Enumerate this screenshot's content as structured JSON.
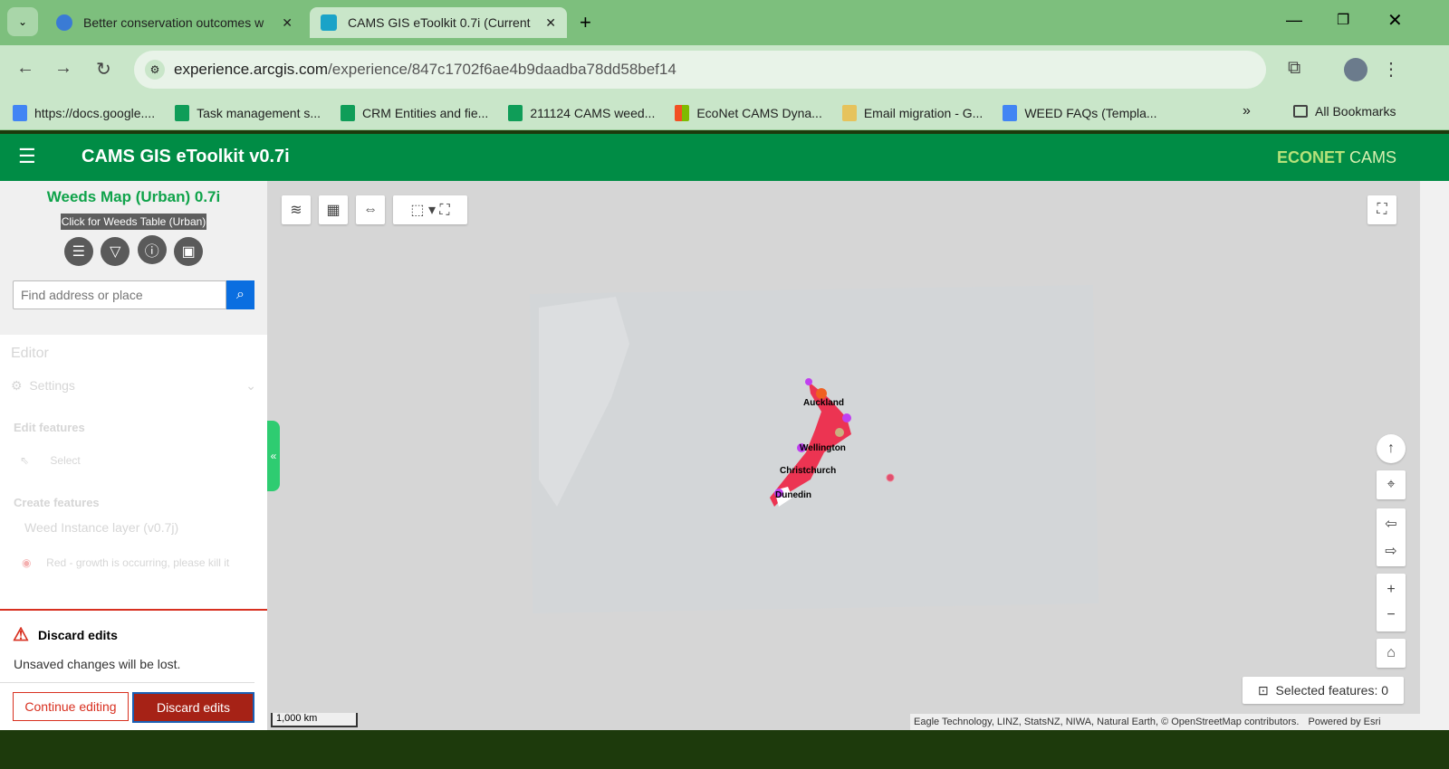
{
  "browser": {
    "tabs": [
      {
        "title": "Better conservation outcomes w",
        "active": false
      },
      {
        "title": "CAMS GIS eToolkit 0.7i (Current",
        "active": true
      }
    ],
    "url_host": "experience.arcgis.com",
    "url_path": "/experience/847c1702f6ae4b9daadba78dd58bef14",
    "bookmarks": [
      "https://docs.google....",
      "Task management s...",
      "CRM Entities and fie...",
      "211124 CAMS weed...",
      "EcoNet CAMS Dyna...",
      "Email migration - G...",
      "WEED FAQs (Templa..."
    ],
    "all_bookmarks": "All Bookmarks"
  },
  "app": {
    "title": "CAMS GIS eToolkit v0.7i",
    "logo_bold": "ECONET",
    "logo_light": "CAMS"
  },
  "sidebar": {
    "map_title": "Weeds Map (Urban) 0.7i",
    "table_link": "Click for Weeds Table (Urban)",
    "search_placeholder": "Find address or place",
    "editor": {
      "title": "Editor",
      "settings": "Settings",
      "edit_features": "Edit features",
      "select": "Select",
      "create_features": "Create features",
      "layer": "Weed Instance layer (v0.7j)",
      "template": "Red - growth is occurring, please kill it"
    },
    "discard": {
      "title": "Discard edits",
      "message": "Unsaved changes will be lost.",
      "continue": "Continue editing",
      "discard": "Discard edits"
    }
  },
  "map": {
    "labels": [
      "Auckland",
      "Wellington",
      "Christchurch",
      "Dunedin"
    ],
    "scale": "1,000 km",
    "attribution": "Eagle Technology, LINZ, StatsNZ, NIWA, Natural Earth, © OpenStreetMap contributors.",
    "powered": "Powered by Esri",
    "selected_features": "Selected features: 0"
  }
}
